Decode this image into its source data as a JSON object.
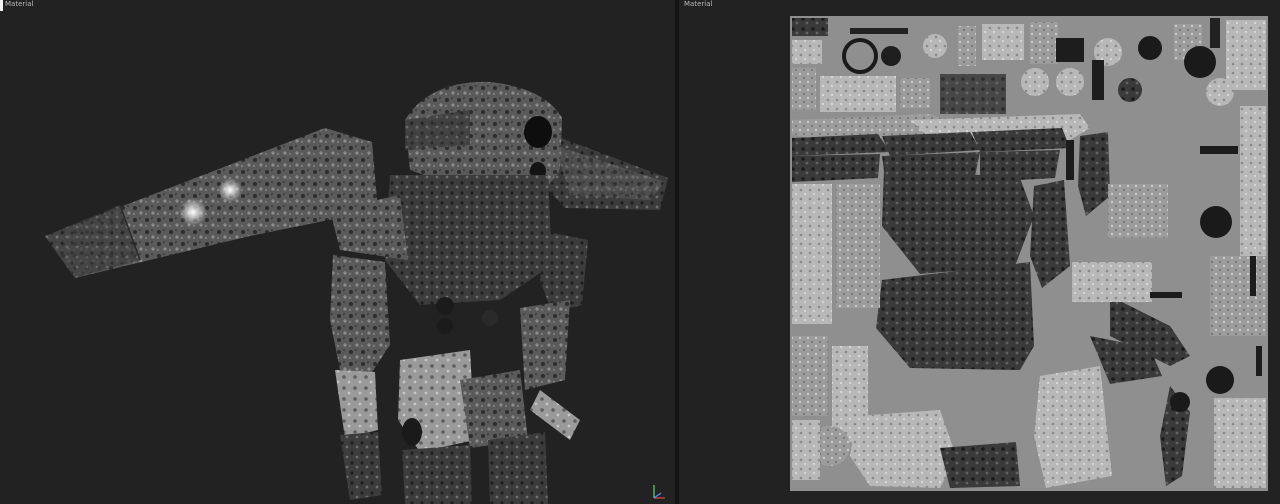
{
  "left_viewport": {
    "label": "Material",
    "model": "robot-mech-mesh"
  },
  "right_viewport": {
    "label": "Material",
    "content": "uv-texture-atlas"
  },
  "gizmo": {
    "axes": [
      "y",
      "z",
      "x"
    ],
    "colors": {
      "x": "#d94b4b",
      "y": "#6ed36e",
      "z": "#5b8cf0"
    }
  },
  "colors": {
    "viewport_bg": "#222222",
    "atlas_bg": "#8f8f8f",
    "label_text": "#b9b9b9"
  }
}
